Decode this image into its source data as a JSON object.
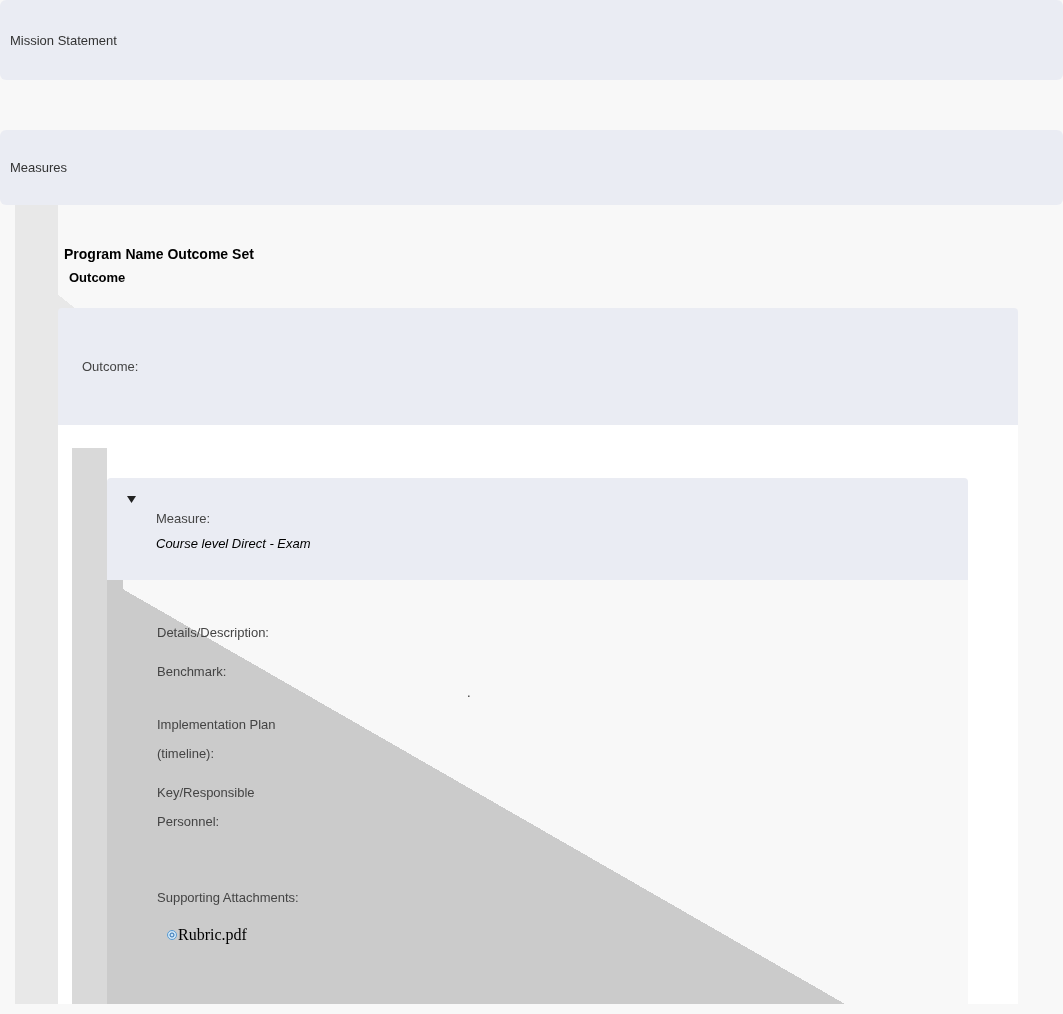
{
  "sections": [
    {
      "title": "Mission Statement"
    },
    {
      "title": "Measures"
    }
  ],
  "outcome_set": {
    "title": "Program Name Outcome Set",
    "subtitle": "Outcome"
  },
  "outcome": {
    "label": "Outcome:"
  },
  "measure": {
    "expanded": true,
    "label": "Measure:",
    "name": "Course level Direct - Exam",
    "fields": [
      {
        "label": "Details/Description:"
      },
      {
        "label": "Benchmark:",
        "value": "."
      },
      {
        "label": "Implementation Plan (timeline):"
      },
      {
        "label": "Key/Responsible Personnel:"
      }
    ],
    "attachments_label": "Supporting Attachments:",
    "attachments": [
      {
        "name": "Rubric.pdf"
      }
    ]
  }
}
